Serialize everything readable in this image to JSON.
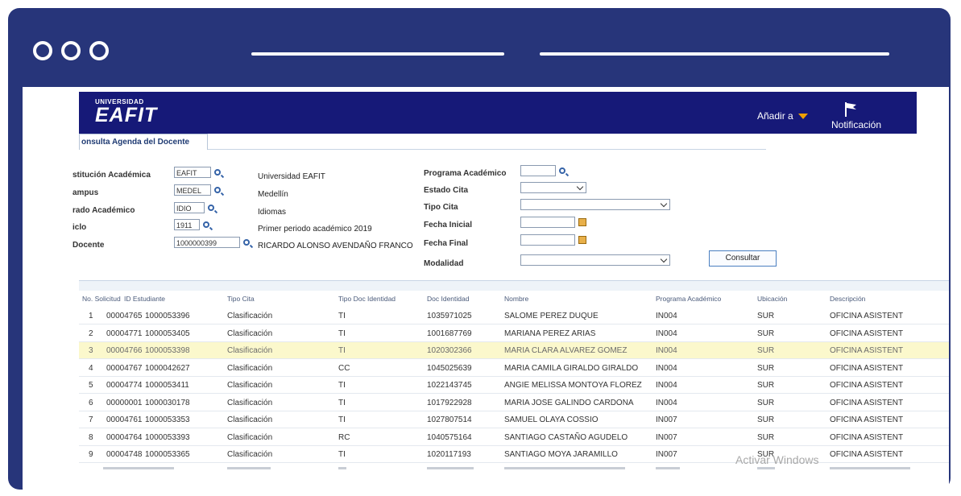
{
  "header": {
    "logo_small": "UNIVERSIDAD",
    "logo_big": "EAFIT",
    "add_label": "Añadir a",
    "notifications_label": "Notificación"
  },
  "tab": {
    "label": "onsulta Agenda del Docente"
  },
  "form": {
    "institucion": {
      "label": "stitución Académica",
      "value": "EAFIT",
      "desc": "Universidad EAFIT"
    },
    "campus": {
      "label": "ampus",
      "value": "MEDEL",
      "desc": "Medellín"
    },
    "grado": {
      "label": "rado Académico",
      "value": "IDIO",
      "desc": "Idiomas"
    },
    "ciclo": {
      "label": "iclo",
      "value": "1911",
      "desc": "Primer periodo académico 2019"
    },
    "docente": {
      "label": "Docente",
      "value": "1000000399",
      "desc": "RICARDO ALONSO AVENDAÑO FRANCO"
    },
    "programa": {
      "label": "Programa Académico",
      "value": ""
    },
    "estado": {
      "label": "Estado Cita",
      "value": ""
    },
    "tipo": {
      "label": "Tipo Cita",
      "value": ""
    },
    "fecha_inicial": {
      "label": "Fecha Inicial",
      "value": ""
    },
    "fecha_final": {
      "label": "Fecha Final",
      "value": ""
    },
    "modalidad": {
      "label": "Modalidad",
      "value": ""
    },
    "consultar": "Consultar"
  },
  "table": {
    "headers": [
      "No. Solicitud",
      "ID Estudiante",
      "Tipo Cita",
      "Tipo Doc Identidad",
      "Doc Identidad",
      "Nombre",
      "Programa Académico",
      "Ubicación",
      "Descripción"
    ],
    "rows": [
      {
        "n": "1",
        "sol": "00004765",
        "id": "1000053396",
        "tipo": "Clasificación",
        "td": "TI",
        "doc": "1035971025",
        "nombre": "SALOME PEREZ DUQUE",
        "prog": "IN004",
        "ubic": "SUR",
        "desc": "OFICINA ASISTENT"
      },
      {
        "n": "2",
        "sol": "00004771",
        "id": "1000053405",
        "tipo": "Clasificación",
        "td": "TI",
        "doc": "1001687769",
        "nombre": "MARIANA PEREZ ARIAS",
        "prog": "IN004",
        "ubic": "SUR",
        "desc": "OFICINA ASISTENT"
      },
      {
        "n": "3",
        "sol": "00004766",
        "id": "1000053398",
        "tipo": "Clasificación",
        "td": "TI",
        "doc": "1020302366",
        "nombre": "MARIA CLARA ALVAREZ GOMEZ",
        "prog": "IN004",
        "ubic": "SUR",
        "desc": "OFICINA ASISTENT"
      },
      {
        "n": "4",
        "sol": "00004767",
        "id": "1000042627",
        "tipo": "Clasificación",
        "td": "CC",
        "doc": "1045025639",
        "nombre": "MARIA CAMILA GIRALDO GIRALDO",
        "prog": "IN004",
        "ubic": "SUR",
        "desc": "OFICINA ASISTENT"
      },
      {
        "n": "5",
        "sol": "00004774",
        "id": "1000053411",
        "tipo": "Clasificación",
        "td": "TI",
        "doc": "1022143745",
        "nombre": "ANGIE MELISSA MONTOYA FLOREZ",
        "prog": "IN004",
        "ubic": "SUR",
        "desc": "OFICINA ASISTENT"
      },
      {
        "n": "6",
        "sol": "00000001",
        "id": "1000030178",
        "tipo": "Clasificación",
        "td": "TI",
        "doc": "1017922928",
        "nombre": "MARIA JOSE GALINDO CARDONA",
        "prog": "IN004",
        "ubic": "SUR",
        "desc": "OFICINA ASISTENT"
      },
      {
        "n": "7",
        "sol": "00004761",
        "id": "1000053353",
        "tipo": "Clasificación",
        "td": "TI",
        "doc": "1027807514",
        "nombre": "SAMUEL OLAYA COSSIO",
        "prog": "IN007",
        "ubic": "SUR",
        "desc": "OFICINA ASISTENT"
      },
      {
        "n": "8",
        "sol": "00004764",
        "id": "1000053393",
        "tipo": "Clasificación",
        "td": "RC",
        "doc": "1040575164",
        "nombre": "SANTIAGO CASTAÑO AGUDELO",
        "prog": "IN007",
        "ubic": "SUR",
        "desc": "OFICINA ASISTENT"
      },
      {
        "n": "9",
        "sol": "00004748",
        "id": "1000053365",
        "tipo": "Clasificación",
        "td": "TI",
        "doc": "1020117193",
        "nombre": "SANTIAGO MOYA JARAMILLO",
        "prog": "IN007",
        "ubic": "SUR",
        "desc": "OFICINA ASISTENT"
      }
    ]
  },
  "watermark": "Activar Windows",
  "colors": {
    "frame": "#27357a",
    "header": "#161978",
    "highlight_row": "#fbf8cc",
    "accent": "#f0a000"
  }
}
